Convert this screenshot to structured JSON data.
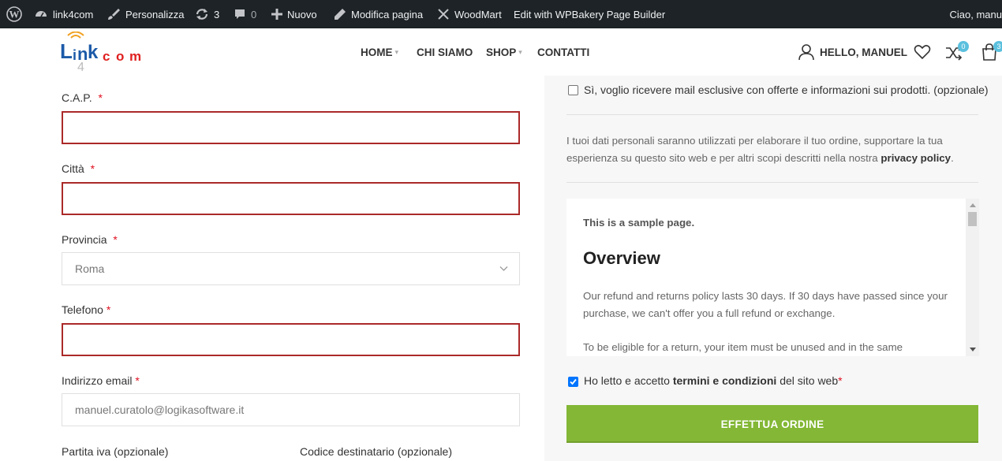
{
  "adminbar": {
    "wp_icon": "wordpress-icon",
    "site_name": "link4com",
    "customize": "Personalizza",
    "updates_count": "3",
    "comments_count": "0",
    "new": "Nuovo",
    "edit_page": "Modifica pagina",
    "woodmart": "WoodMart",
    "wpbakery": "Edit with WPBakery Page Builder",
    "greeting": "Ciao, manu"
  },
  "header": {
    "logo_letters": [
      "L",
      "i",
      "n",
      "k",
      "c",
      "o",
      "m"
    ],
    "logo_digit": "4",
    "nav": [
      {
        "label": "HOME",
        "has_dropdown": true
      },
      {
        "label": "CHI SIAMO",
        "has_dropdown": false
      },
      {
        "label": "SHOP",
        "has_dropdown": true
      },
      {
        "label": "CONTATTI",
        "has_dropdown": false
      }
    ],
    "hello": "HELLO, MANUEL",
    "compare_count": "0",
    "cart_count": "3"
  },
  "form": {
    "cap_label": "C.A.P.",
    "city_label": "Città",
    "province_label": "Provincia",
    "province_value": "Roma",
    "phone_label": "Telefono",
    "email_label": "Indirizzo email",
    "email_value": "manuel.curatolo@logikasoftware.it",
    "vat_label": "Partita iva (opzionale)",
    "recipient_code_label": "Codice destinatario (opzionale)",
    "required_mark": "*"
  },
  "sidebar": {
    "newsletter_label": "Sì, voglio ricevere mail esclusive con offerte e informazioni sui prodotti. (opzionale)",
    "privacy_text": "I tuoi dati personali saranno utilizzati per elaborare il tuo ordine, supportare la tua esperienza su questo sito web e per altri scopi descritti nella nostra",
    "privacy_link": "privacy policy",
    "privacy_end": ".",
    "terms_box": {
      "sample": "This is a sample page.",
      "heading": "Overview",
      "p1": "Our refund and returns policy lasts 30 days. If 30 days have passed since your purchase, we can't offer you a full refund or exchange.",
      "p2": "To be eligible for a return, your item must be unused and in the same"
    },
    "terms_pre": "Ho letto e accetto",
    "terms_link": "termini e condizioni",
    "terms_post": "del sito web",
    "terms_checked": true,
    "order_button": "EFFETTUA ORDINE"
  },
  "colors": {
    "adminbar_bg": "#1d2327",
    "error_border": "#ab2929",
    "button_green": "#83b735",
    "badge_blue": "#5bc0de",
    "required_red": "#e01020"
  }
}
